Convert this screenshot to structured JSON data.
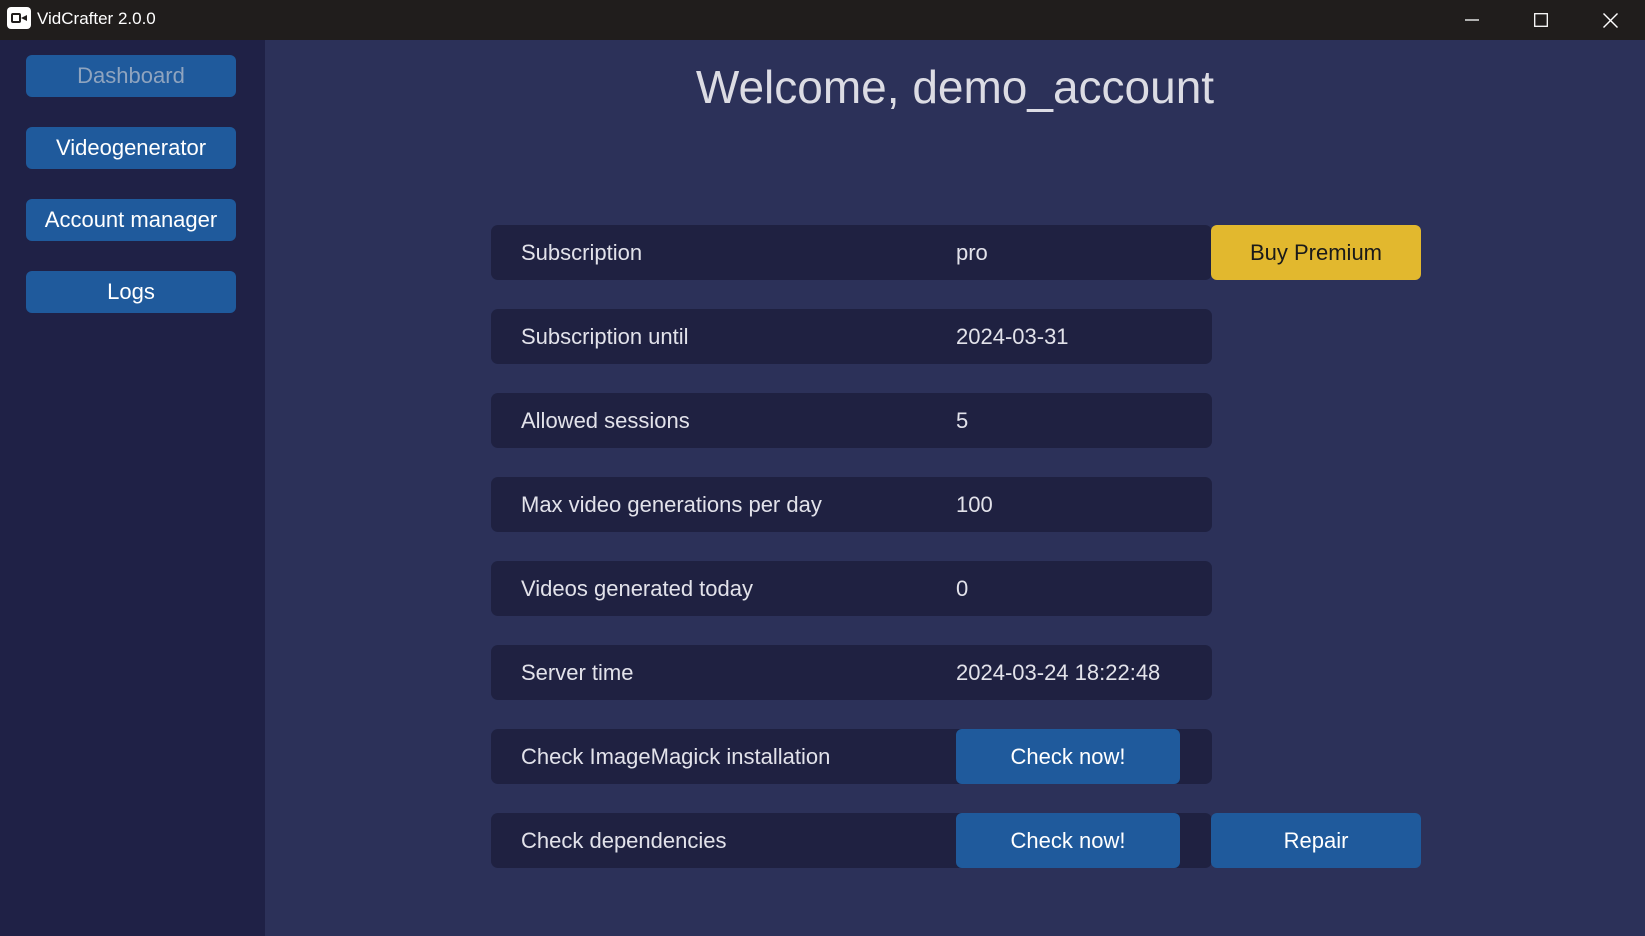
{
  "window": {
    "title": "VidCrafter 2.0.0"
  },
  "sidebar": {
    "items": [
      {
        "label": "Dashboard"
      },
      {
        "label": "Videogenerator"
      },
      {
        "label": "Account manager"
      },
      {
        "label": "Logs"
      }
    ]
  },
  "main": {
    "title": "Welcome, demo_account",
    "rows": [
      {
        "label": "Subscription",
        "value": "pro"
      },
      {
        "label": "Subscription until",
        "value": "2024-03-31"
      },
      {
        "label": "Allowed sessions",
        "value": "5"
      },
      {
        "label": "Max video generations per day",
        "value": "100"
      },
      {
        "label": "Videos generated today",
        "value": "0"
      },
      {
        "label": "Server time",
        "value": "2024-03-24 18:22:48"
      },
      {
        "label": "Check ImageMagick installation"
      },
      {
        "label": "Check dependencies"
      }
    ],
    "buttons": {
      "buy_premium": "Buy Premium",
      "check_imagemagick": "Check now!",
      "check_dependencies": "Check now!",
      "repair": "Repair"
    }
  },
  "colors": {
    "titlebar": "#201d1c",
    "sidebar": "#1f2146",
    "main_bg": "#2c3159",
    "row_bg": "#1f2141",
    "button_blue": "#1f5a9c",
    "button_premium": "#e2b82e",
    "active_nav_text": "#8fa4bf"
  },
  "icons": {
    "app": "video-camera-icon",
    "minimize": "minimize-icon",
    "maximize": "maximize-icon",
    "close": "close-icon"
  }
}
